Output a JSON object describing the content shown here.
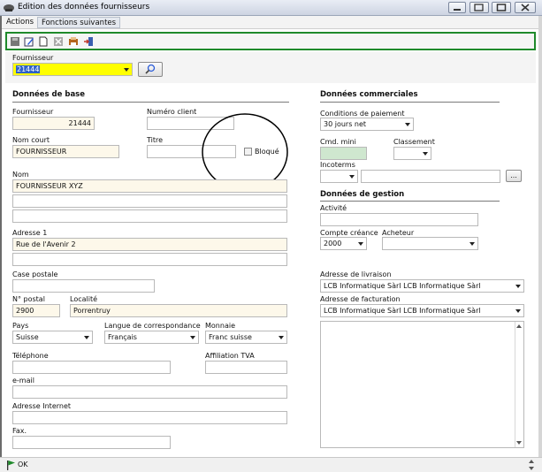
{
  "window": {
    "title": "Edition des données fournisseurs"
  },
  "menu": {
    "items": [
      "Actions",
      "Fonctions suivantes"
    ]
  },
  "toolbar": {
    "icons": [
      "save-icon",
      "edit-icon",
      "new-document-icon",
      "delete-icon",
      "print-icon",
      "exit-icon"
    ]
  },
  "supplier_select": {
    "label": "Fournisseur",
    "value": "21444"
  },
  "base": {
    "title": "Données de base",
    "fournisseur_label": "Fournisseur",
    "fournisseur_value": "21444",
    "numero_client_label": "Numéro client",
    "numero_client_value": "",
    "nom_court_label": "Nom court",
    "nom_court_value": "FOURNISSEUR",
    "titre_label": "Titre",
    "titre_value": "",
    "bloque_label": "Bloqué",
    "nom_label": "Nom",
    "nom_value": "FOURNISSEUR XYZ",
    "adresse1_label": "Adresse 1",
    "adresse1_value": "Rue de l'Avenir 2",
    "case_postale_label": "Case postale",
    "npa_label": "N° postal",
    "npa_value": "2900",
    "localite_label": "Localité",
    "localite_value": "Porrentruy",
    "pays_label": "Pays",
    "pays_value": "Suisse",
    "langue_label": "Langue de correspondance",
    "langue_value": "Français",
    "monnaie_label": "Monnaie",
    "monnaie_value": "Franc suisse",
    "telephone_label": "Téléphone",
    "tva_label": "Affiliation TVA",
    "email_label": "e-mail",
    "internet_label": "Adresse Internet",
    "fax_label": "Fax."
  },
  "commercial": {
    "title": "Données commerciales",
    "conditions_label": "Conditions de paiement",
    "conditions_value": "30 jours net",
    "cmd_mini_label": "Cmd. mini",
    "classement_label": "Classement",
    "incoterms_label": "Incoterms",
    "browse_label": "..."
  },
  "gestion": {
    "title": "Données de gestion",
    "activite_label": "Activité",
    "compte_label": "Compte créance",
    "compte_value": "2000",
    "acheteur_label": "Acheteur",
    "livraison_label": "Adresse de livraison",
    "livraison_value": "LCB Informatique Sàrl LCB Informatique Sàrl",
    "facturation_label": "Adresse de facturation",
    "facturation_value": "LCB Informatique Sàrl LCB Informatique Sàrl"
  },
  "status": {
    "text": "OK"
  },
  "colors": {
    "toolbar_border": "#1f8a2b",
    "supplier_highlight": "#ffff00",
    "selection": "#2f62c8"
  }
}
